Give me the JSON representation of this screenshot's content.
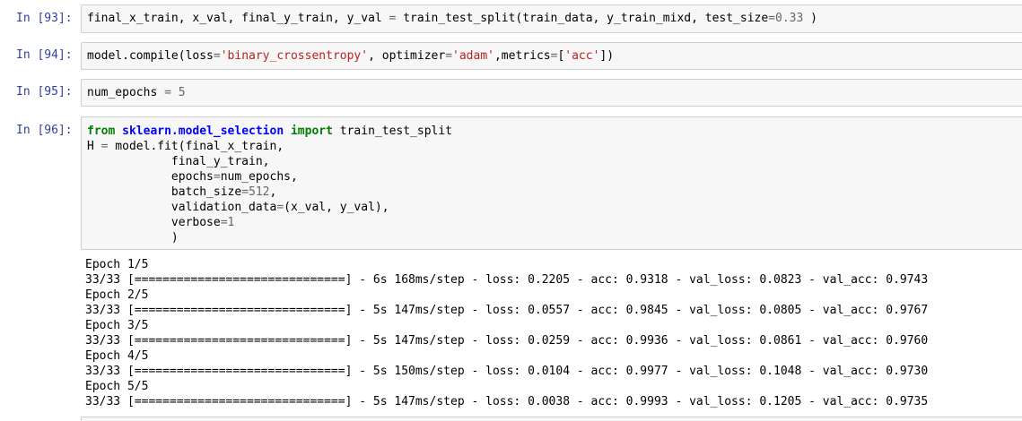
{
  "cells": [
    {
      "prompt": "In [93]:",
      "lines": [
        [
          {
            "t": "final_x_train, x_val, final_y_train, y_val ",
            "c": ""
          },
          {
            "t": "=",
            "c": "op"
          },
          {
            "t": " train_test_split(train_data, y_train_mixd, test_size",
            "c": ""
          },
          {
            "t": "=",
            "c": "op"
          },
          {
            "t": "0.33",
            "c": "num"
          },
          {
            "t": " )",
            "c": ""
          }
        ]
      ]
    },
    {
      "prompt": "In [94]:",
      "lines": [
        [
          {
            "t": "model.compile(loss",
            "c": ""
          },
          {
            "t": "=",
            "c": "op"
          },
          {
            "t": "'binary_crossentropy'",
            "c": "str"
          },
          {
            "t": ", optimizer",
            "c": ""
          },
          {
            "t": "=",
            "c": "op"
          },
          {
            "t": "'adam'",
            "c": "str"
          },
          {
            "t": ",metrics",
            "c": ""
          },
          {
            "t": "=",
            "c": "op"
          },
          {
            "t": "[",
            "c": ""
          },
          {
            "t": "'acc'",
            "c": "str"
          },
          {
            "t": "])",
            "c": ""
          }
        ]
      ]
    },
    {
      "prompt": "In [95]:",
      "lines": [
        [
          {
            "t": "num_epochs ",
            "c": ""
          },
          {
            "t": "=",
            "c": "op"
          },
          {
            "t": " ",
            "c": ""
          },
          {
            "t": "5",
            "c": "num"
          }
        ]
      ]
    },
    {
      "prompt": "In [96]:",
      "lines": [
        [
          {
            "t": "from",
            "c": "kw"
          },
          {
            "t": " ",
            "c": ""
          },
          {
            "t": "sklearn.model_selection",
            "c": "mod"
          },
          {
            "t": " ",
            "c": ""
          },
          {
            "t": "import",
            "c": "kw"
          },
          {
            "t": " train_test_split",
            "c": ""
          }
        ],
        [
          {
            "t": "H ",
            "c": ""
          },
          {
            "t": "=",
            "c": "op"
          },
          {
            "t": " model.fit(final_x_train,",
            "c": ""
          }
        ],
        [
          {
            "t": "            final_y_train,",
            "c": ""
          }
        ],
        [
          {
            "t": "            epochs",
            "c": ""
          },
          {
            "t": "=",
            "c": "op"
          },
          {
            "t": "num_epochs,",
            "c": ""
          }
        ],
        [
          {
            "t": "            batch_size",
            "c": ""
          },
          {
            "t": "=",
            "c": "op"
          },
          {
            "t": "512",
            "c": "num"
          },
          {
            "t": ",",
            "c": ""
          }
        ],
        [
          {
            "t": "            validation_data",
            "c": ""
          },
          {
            "t": "=",
            "c": "op"
          },
          {
            "t": "(x_val, y_val),",
            "c": ""
          }
        ],
        [
          {
            "t": "            verbose",
            "c": ""
          },
          {
            "t": "=",
            "c": "op"
          },
          {
            "t": "1",
            "c": "num"
          }
        ],
        [
          {
            "t": "            )",
            "c": ""
          }
        ]
      ]
    }
  ],
  "output": [
    "Epoch 1/5",
    "33/33 [==============================] - 6s 168ms/step - loss: 0.2205 - acc: 0.9318 - val_loss: 0.0823 - val_acc: 0.9743",
    "Epoch 2/5",
    "33/33 [==============================] - 5s 147ms/step - loss: 0.0557 - acc: 0.9845 - val_loss: 0.0805 - val_acc: 0.9767",
    "Epoch 3/5",
    "33/33 [==============================] - 5s 147ms/step - loss: 0.0259 - acc: 0.9936 - val_loss: 0.0861 - val_acc: 0.9760",
    "Epoch 4/5",
    "33/33 [==============================] - 5s 150ms/step - loss: 0.0104 - acc: 0.9977 - val_loss: 0.1048 - val_acc: 0.9730",
    "Epoch 5/5",
    "33/33 [==============================] - 5s 147ms/step - loss: 0.0038 - acc: 0.9993 - val_loss: 0.1205 - val_acc: 0.9735"
  ]
}
